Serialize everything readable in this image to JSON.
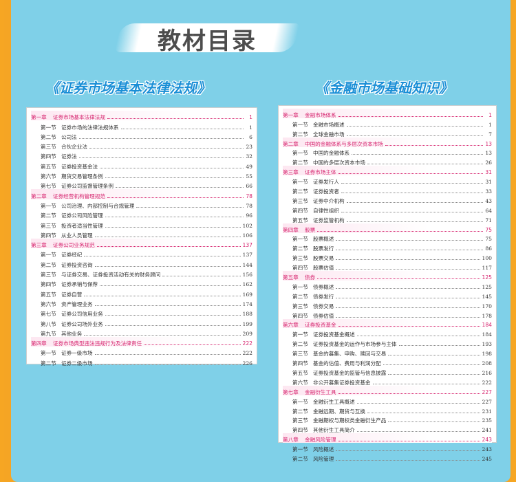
{
  "header": {
    "title": "教材目录"
  },
  "left_book": {
    "title": "《证券市场基本法律法规》",
    "entries": [
      {
        "type": "chapter",
        "label": "第一章",
        "name": "证券市场基本法律法规",
        "page": "1"
      },
      {
        "type": "section",
        "label": "第一节",
        "name": "证券市场的法律法规体系",
        "page": "1"
      },
      {
        "type": "section",
        "label": "第二节",
        "name": "公司法",
        "page": "6"
      },
      {
        "type": "section",
        "label": "第三节",
        "name": "合伙企业法",
        "page": "23"
      },
      {
        "type": "section",
        "label": "第四节",
        "name": "证券法",
        "page": "32"
      },
      {
        "type": "section",
        "label": "第五节",
        "name": "证券投资基金法",
        "page": "49"
      },
      {
        "type": "section",
        "label": "第六节",
        "name": "期货交易管理条例",
        "page": "55"
      },
      {
        "type": "section",
        "label": "第七节",
        "name": "证券公司监督管理条例",
        "page": "66"
      },
      {
        "type": "chapter",
        "label": "第二章",
        "name": "证券经营机构管理规范",
        "page": "78"
      },
      {
        "type": "section",
        "label": "第一节",
        "name": "公司治理、内部控制与合规管理",
        "page": "78"
      },
      {
        "type": "section",
        "label": "第二节",
        "name": "证券公司风险管理",
        "page": "96"
      },
      {
        "type": "section",
        "label": "第三节",
        "name": "投资者适当性管理",
        "page": "102"
      },
      {
        "type": "section",
        "label": "第四节",
        "name": "从业人员管理",
        "page": "106"
      },
      {
        "type": "chapter",
        "label": "第三章",
        "name": "证券公司业务规范",
        "page": "137"
      },
      {
        "type": "section",
        "label": "第一节",
        "name": "证券经纪",
        "page": "137"
      },
      {
        "type": "section",
        "label": "第二节",
        "name": "证券投资咨询",
        "page": "144"
      },
      {
        "type": "section",
        "label": "第三节",
        "name": "与证券交易、证券投资活动有关的财务顾问",
        "page": "156"
      },
      {
        "type": "section",
        "label": "第四节",
        "name": "证券承销与保荐",
        "page": "162"
      },
      {
        "type": "section",
        "label": "第五节",
        "name": "证券自营",
        "page": "169"
      },
      {
        "type": "section",
        "label": "第六节",
        "name": "资产管理业务",
        "page": "174"
      },
      {
        "type": "section",
        "label": "第七节",
        "name": "证券公司信用业务",
        "page": "188"
      },
      {
        "type": "section",
        "label": "第八节",
        "name": "证券公司场外业务",
        "page": "199"
      },
      {
        "type": "section",
        "label": "第九节",
        "name": "其他业务",
        "page": "209"
      },
      {
        "type": "chapter",
        "label": "第四章",
        "name": "证券市场典型违法违规行为及法律责任",
        "page": "222"
      },
      {
        "type": "section",
        "label": "第一节",
        "name": "证券一级市场",
        "page": "222"
      },
      {
        "type": "section",
        "label": "第二节",
        "name": "证券二级市场",
        "page": "226"
      }
    ]
  },
  "right_book": {
    "title": "《金融市场基础知识》",
    "entries": [
      {
        "type": "chapter",
        "label": "第一章",
        "name": "金融市场体系",
        "page": "1"
      },
      {
        "type": "section",
        "label": "第一节",
        "name": "金融市场概述",
        "page": "1"
      },
      {
        "type": "section",
        "label": "第二节",
        "name": "全球金融市场",
        "page": "7"
      },
      {
        "type": "chapter",
        "label": "第二章",
        "name": "中国的金融体系与多层次资本市场",
        "page": "13"
      },
      {
        "type": "section",
        "label": "第一节",
        "name": "中国的金融体系",
        "page": "13"
      },
      {
        "type": "section",
        "label": "第二节",
        "name": "中国的多层次资本市场",
        "page": "26"
      },
      {
        "type": "chapter",
        "label": "第三章",
        "name": "证券市场主体",
        "page": "31"
      },
      {
        "type": "section",
        "label": "第一节",
        "name": "证券发行人",
        "page": "31"
      },
      {
        "type": "section",
        "label": "第二节",
        "name": "证券投资者",
        "page": "33"
      },
      {
        "type": "section",
        "label": "第三节",
        "name": "证券中介机构",
        "page": "43"
      },
      {
        "type": "section",
        "label": "第四节",
        "name": "自律性组织",
        "page": "64"
      },
      {
        "type": "section",
        "label": "第五节",
        "name": "证券监管机构",
        "page": "71"
      },
      {
        "type": "chapter",
        "label": "第四章",
        "name": "股票",
        "page": "75"
      },
      {
        "type": "section",
        "label": "第一节",
        "name": "股票概述",
        "page": "75"
      },
      {
        "type": "section",
        "label": "第二节",
        "name": "股票发行",
        "page": "86"
      },
      {
        "type": "section",
        "label": "第三节",
        "name": "股票交易",
        "page": "100"
      },
      {
        "type": "section",
        "label": "第四节",
        "name": "股票估值",
        "page": "117"
      },
      {
        "type": "chapter",
        "label": "第五章",
        "name": "债券",
        "page": "125"
      },
      {
        "type": "section",
        "label": "第一节",
        "name": "债券概述",
        "page": "125"
      },
      {
        "type": "section",
        "label": "第二节",
        "name": "债券发行",
        "page": "145"
      },
      {
        "type": "section",
        "label": "第三节",
        "name": "债券交易",
        "page": "170"
      },
      {
        "type": "section",
        "label": "第四节",
        "name": "债券估值",
        "page": "178"
      },
      {
        "type": "chapter",
        "label": "第六章",
        "name": "证券投资基金",
        "page": "184"
      },
      {
        "type": "section",
        "label": "第一节",
        "name": "证券投资基金概述",
        "page": "184"
      },
      {
        "type": "section",
        "label": "第二节",
        "name": "证券投资基金的运作与市场参与主体",
        "page": "193"
      },
      {
        "type": "section",
        "label": "第三节",
        "name": "基金的募集、申购、赎回与交易",
        "page": "198"
      },
      {
        "type": "section",
        "label": "第四节",
        "name": "基金的估值、费用与利润分配",
        "page": "208"
      },
      {
        "type": "section",
        "label": "第五节",
        "name": "证券投资基金的监管与信息披露",
        "page": "216"
      },
      {
        "type": "section",
        "label": "第六节",
        "name": "非公开募集证券投资基金",
        "page": "222"
      },
      {
        "type": "chapter",
        "label": "第七章",
        "name": "金融衍生工具",
        "page": "227"
      },
      {
        "type": "section",
        "label": "第一节",
        "name": "金融衍生工具概述",
        "page": "227"
      },
      {
        "type": "section",
        "label": "第二节",
        "name": "金融远期、期货与互换",
        "page": "231"
      },
      {
        "type": "section",
        "label": "第三节",
        "name": "金融期权与期权类金融衍生产品",
        "page": "235"
      },
      {
        "type": "section",
        "label": "第四节",
        "name": "其他衍生工具简介",
        "page": "241"
      },
      {
        "type": "chapter",
        "label": "第八章",
        "name": "金融风险管理",
        "page": "243"
      },
      {
        "type": "section",
        "label": "第一节",
        "name": "风险概述",
        "page": "243"
      },
      {
        "type": "section",
        "label": "第二节",
        "name": "风险管理",
        "page": "245"
      }
    ]
  }
}
